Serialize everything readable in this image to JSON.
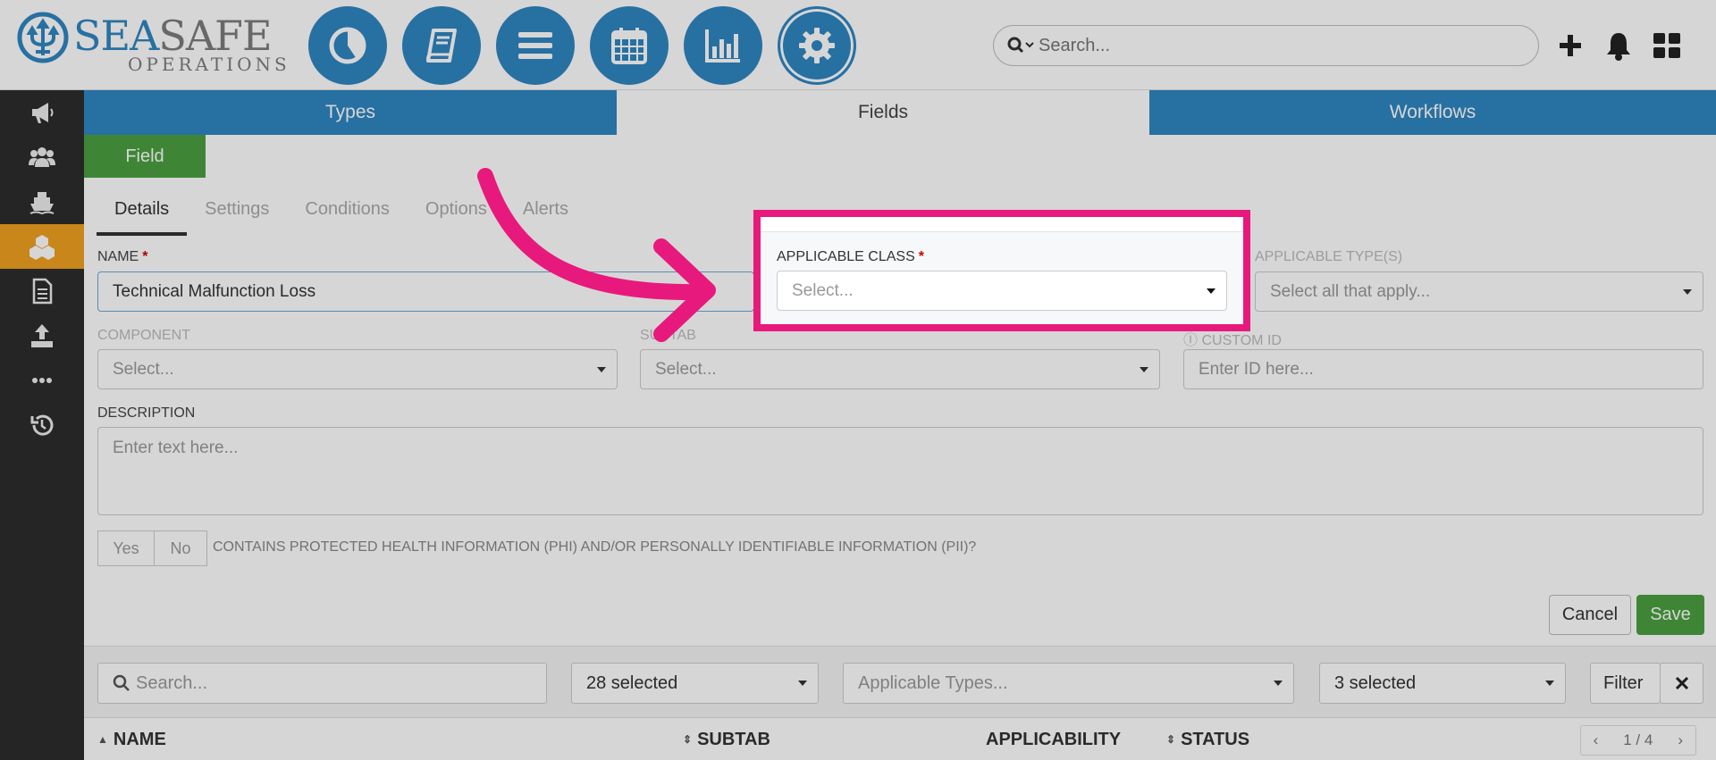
{
  "brand": {
    "line1_a": "SEA",
    "line1_b": "SAFE",
    "line2": "OPERATIONS"
  },
  "header": {
    "modules": [
      {
        "name": "dashboard",
        "icon": "pie-chart-icon"
      },
      {
        "name": "logbook",
        "icon": "book-icon"
      },
      {
        "name": "list",
        "icon": "list-icon"
      },
      {
        "name": "calendar",
        "icon": "calendar-icon"
      },
      {
        "name": "reports",
        "icon": "bar-chart-icon"
      },
      {
        "name": "settings",
        "icon": "gear-icon"
      }
    ],
    "search_placeholder": "Search..."
  },
  "sidebar": {
    "items": [
      {
        "icon": "megaphone-icon"
      },
      {
        "icon": "users-icon"
      },
      {
        "icon": "ship-icon"
      },
      {
        "icon": "cubes-icon",
        "active": true
      },
      {
        "icon": "document-icon"
      },
      {
        "icon": "upload-icon"
      },
      {
        "icon": "ellipsis-icon"
      },
      {
        "icon": "history-icon"
      }
    ]
  },
  "tabs": [
    "Types",
    "Fields",
    "Workflows"
  ],
  "field_button": "Field",
  "subtabs": [
    "Details",
    "Settings",
    "Conditions",
    "Options",
    "Alerts"
  ],
  "form": {
    "name_label": "NAME",
    "name_value": "Technical Malfunction Loss",
    "applicable_class_label": "APPLICABLE CLASS",
    "applicable_class_placeholder": "Select...",
    "applicable_types_label": "APPLICABLE TYPE(S)",
    "applicable_types_placeholder": "Select all that apply...",
    "component_label": "COMPONENT",
    "component_placeholder": "Select...",
    "subtab_label": "SUBTAB",
    "subtab_placeholder": "Select...",
    "custom_id_label": "CUSTOM ID",
    "custom_id_placeholder": "Enter ID here...",
    "description_label": "DESCRIPTION",
    "description_placeholder": "Enter text here...",
    "yes": "Yes",
    "no": "No",
    "phi_text": "CONTAINS PROTECTED HEALTH INFORMATION (PHI) AND/OR PERSONALLY IDENTIFIABLE INFORMATION (PII)?",
    "cancel": "Cancel",
    "save": "Save"
  },
  "filters": {
    "search_placeholder": "Search...",
    "select1": "28 selected",
    "select2_placeholder": "Applicable Types...",
    "select3": "3 selected",
    "filter_button": "Filter",
    "clear_icon": "close-icon"
  },
  "table": {
    "columns": [
      "NAME",
      "SUBTAB",
      "APPLICABILITY",
      "STATUS"
    ],
    "pager": "1 / 4"
  },
  "colors": {
    "primary": "#2f86c1",
    "green": "#4aa041",
    "highlight": "#e8197c",
    "sidebar_active": "#f0a020"
  }
}
